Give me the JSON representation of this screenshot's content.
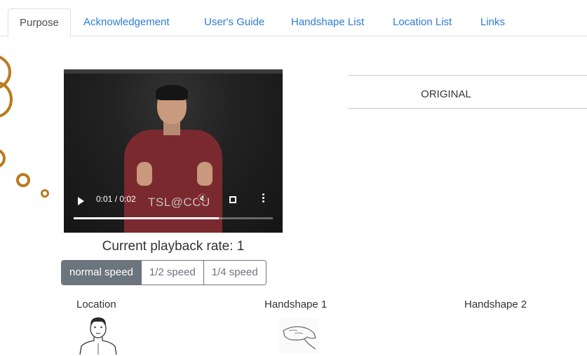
{
  "tabs": [
    {
      "label": "Purpose",
      "active": true
    },
    {
      "label": "Acknowledgement",
      "active": false
    },
    {
      "label": "User's Guide",
      "active": false
    },
    {
      "label": "Handshape List",
      "active": false
    },
    {
      "label": "Location List",
      "active": false
    },
    {
      "label": "Links",
      "active": false
    }
  ],
  "video": {
    "watermark": "TSL@CCU",
    "time": "0:01 / 0:02",
    "progress_fraction": 0.73,
    "icons": [
      "play-icon",
      "volume-icon",
      "fullscreen-icon",
      "more-options-icon"
    ]
  },
  "playback": {
    "rate_text": "Current playback rate: 1",
    "speeds": [
      {
        "label": "normal speed",
        "active": true
      },
      {
        "label": "1/2 speed",
        "active": false
      },
      {
        "label": "1/4 speed",
        "active": false
      }
    ]
  },
  "original": {
    "label": "ORIGINAL"
  },
  "columns": {
    "location": "Location",
    "handshape1": "Handshape 1",
    "handshape2": "Handshape 2"
  },
  "colors": {
    "accent": "#2d7bd6",
    "decor": "#b97a1e",
    "button_active": "#6c757d"
  }
}
